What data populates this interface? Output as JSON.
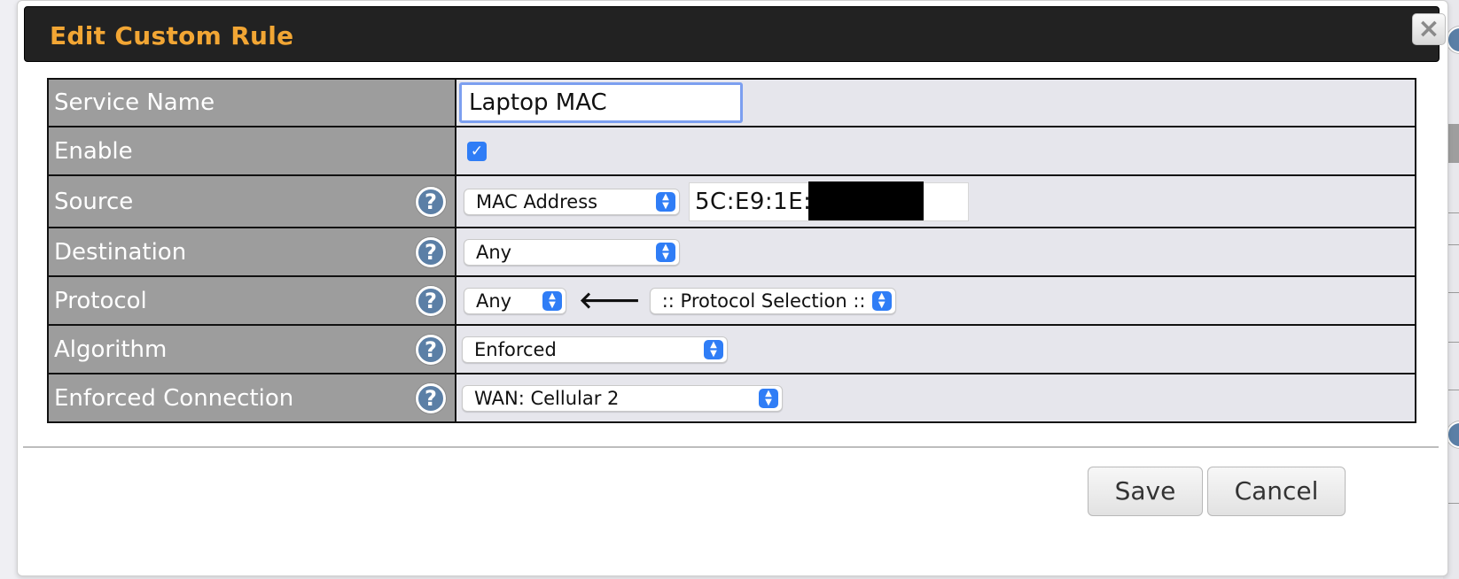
{
  "dialog": {
    "title": "Edit Custom Rule",
    "close_icon_glyph": "×"
  },
  "rows": {
    "service_name": {
      "label": "Service Name",
      "value": "Laptop MAC"
    },
    "enable": {
      "label": "Enable",
      "checked": true,
      "check_glyph": "✓"
    },
    "source": {
      "label": "Source",
      "select": "MAC Address",
      "mac_value": "5C:E9:1E:"
    },
    "destination": {
      "label": "Destination",
      "select": "Any"
    },
    "protocol": {
      "label": "Protocol",
      "select": "Any",
      "arrow_glyph": "🡐",
      "protocol_select": ":: Protocol Selection ::"
    },
    "algorithm": {
      "label": "Algorithm",
      "select": "Enforced"
    },
    "enforced_connection": {
      "label": "Enforced Connection",
      "select": "WAN: Cellular 2"
    }
  },
  "help_glyph": "?",
  "select_arrows": {
    "up": "▲",
    "down": "▼"
  },
  "footer": {
    "save_label": "Save",
    "cancel_label": "Cancel"
  },
  "colors": {
    "title_text": "#f2a634",
    "titlebar_bg": "#222222",
    "label_bg": "#9d9d9d",
    "value_bg": "#e6e6ec",
    "accent_blue": "#2f7df6",
    "help_icon": "#5b7fa6"
  }
}
